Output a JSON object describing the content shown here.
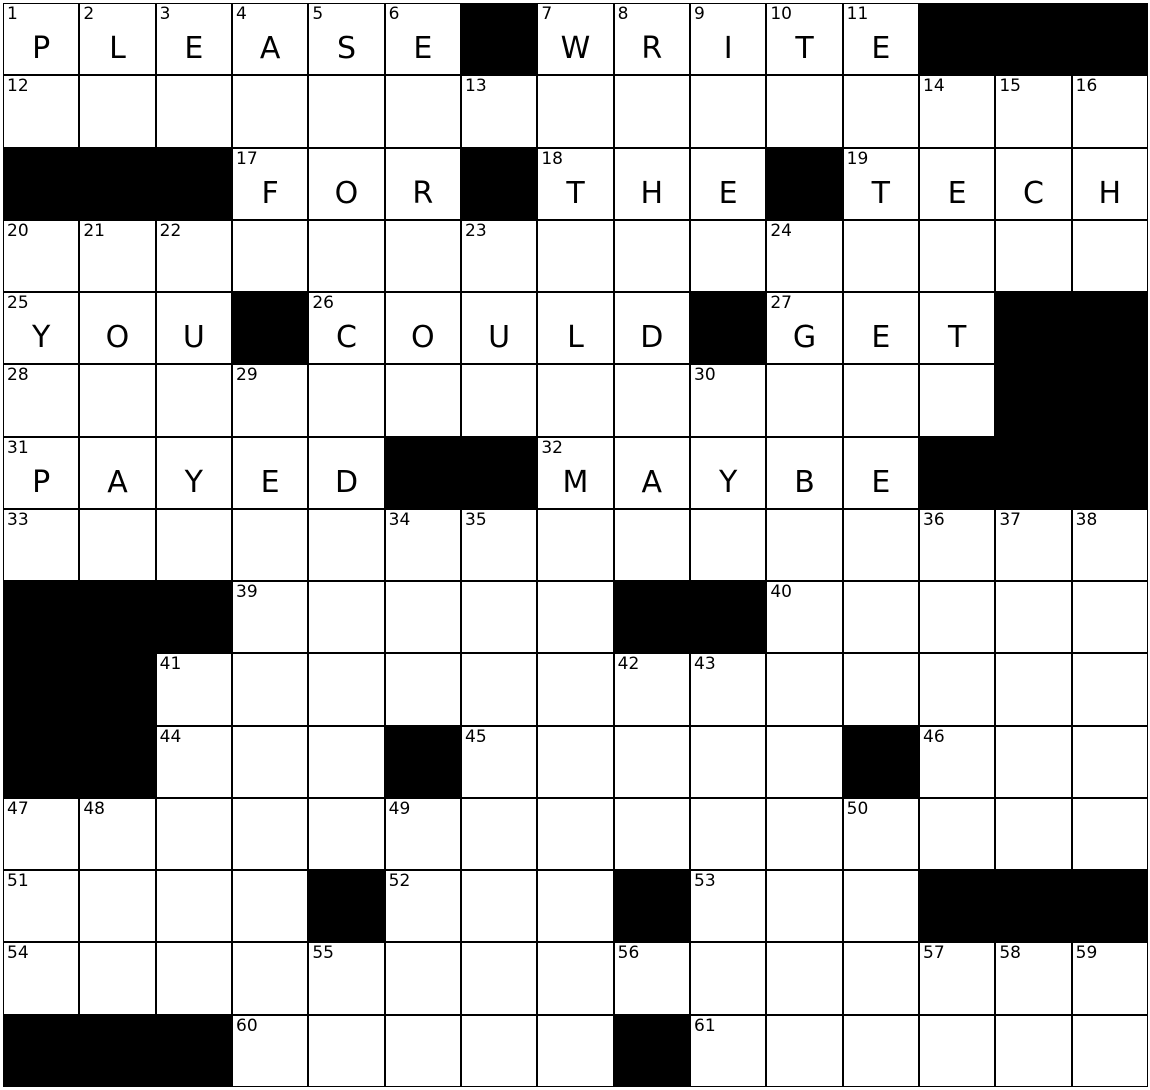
{
  "puzzle": {
    "rows": 15,
    "cols": 15,
    "grid": [
      "PLEASE.WRITE...",
      "...............",
      "...FOR.THE.TECH",
      "...............",
      "YOU.COULD.GET..",
      "...............",
      "PAYED..MAYBE...",
      "...............",
      "...............",
      "...............",
      "...............",
      "...............",
      "...............",
      "...............",
      "..............."
    ],
    "blocks": [
      [
        0,
        6
      ],
      [
        0,
        12
      ],
      [
        0,
        13
      ],
      [
        0,
        14
      ],
      [
        2,
        0
      ],
      [
        2,
        1
      ],
      [
        2,
        2
      ],
      [
        2,
        6
      ],
      [
        2,
        10
      ],
      [
        4,
        3
      ],
      [
        4,
        9
      ],
      [
        4,
        13
      ],
      [
        4,
        14
      ],
      [
        5,
        13
      ],
      [
        5,
        14
      ],
      [
        6,
        5
      ],
      [
        6,
        6
      ],
      [
        6,
        12
      ],
      [
        6,
        13
      ],
      [
        6,
        14
      ],
      [
        8,
        0
      ],
      [
        8,
        1
      ],
      [
        8,
        2
      ],
      [
        8,
        8
      ],
      [
        8,
        9
      ],
      [
        9,
        0
      ],
      [
        9,
        1
      ],
      [
        10,
        0
      ],
      [
        10,
        1
      ],
      [
        10,
        5
      ],
      [
        10,
        11
      ],
      [
        12,
        4
      ],
      [
        12,
        8
      ],
      [
        12,
        12
      ],
      [
        12,
        13
      ],
      [
        12,
        14
      ],
      [
        14,
        0
      ],
      [
        14,
        1
      ],
      [
        14,
        2
      ],
      [
        14,
        8
      ]
    ],
    "letters": [
      [
        0,
        0,
        "P"
      ],
      [
        0,
        1,
        "L"
      ],
      [
        0,
        2,
        "E"
      ],
      [
        0,
        3,
        "A"
      ],
      [
        0,
        4,
        "S"
      ],
      [
        0,
        5,
        "E"
      ],
      [
        0,
        7,
        "W"
      ],
      [
        0,
        8,
        "R"
      ],
      [
        0,
        9,
        "I"
      ],
      [
        0,
        10,
        "T"
      ],
      [
        0,
        11,
        "E"
      ],
      [
        2,
        3,
        "F"
      ],
      [
        2,
        4,
        "O"
      ],
      [
        2,
        5,
        "R"
      ],
      [
        2,
        7,
        "T"
      ],
      [
        2,
        8,
        "H"
      ],
      [
        2,
        9,
        "E"
      ],
      [
        2,
        11,
        "T"
      ],
      [
        2,
        12,
        "E"
      ],
      [
        2,
        13,
        "C"
      ],
      [
        2,
        14,
        "H"
      ],
      [
        4,
        0,
        "Y"
      ],
      [
        4,
        1,
        "O"
      ],
      [
        4,
        2,
        "U"
      ],
      [
        4,
        4,
        "C"
      ],
      [
        4,
        5,
        "O"
      ],
      [
        4,
        6,
        "U"
      ],
      [
        4,
        7,
        "L"
      ],
      [
        4,
        8,
        "D"
      ],
      [
        4,
        10,
        "G"
      ],
      [
        4,
        11,
        "E"
      ],
      [
        4,
        12,
        "T"
      ],
      [
        6,
        0,
        "P"
      ],
      [
        6,
        1,
        "A"
      ],
      [
        6,
        2,
        "Y"
      ],
      [
        6,
        3,
        "E"
      ],
      [
        6,
        4,
        "D"
      ],
      [
        6,
        7,
        "M"
      ],
      [
        6,
        8,
        "A"
      ],
      [
        6,
        9,
        "Y"
      ],
      [
        6,
        10,
        "B"
      ],
      [
        6,
        11,
        "E"
      ]
    ],
    "numbers": [
      [
        0,
        0,
        "1"
      ],
      [
        0,
        1,
        "2"
      ],
      [
        0,
        2,
        "3"
      ],
      [
        0,
        3,
        "4"
      ],
      [
        0,
        4,
        "5"
      ],
      [
        0,
        5,
        "6"
      ],
      [
        0,
        7,
        "7"
      ],
      [
        0,
        8,
        "8"
      ],
      [
        0,
        9,
        "9"
      ],
      [
        0,
        10,
        "10"
      ],
      [
        0,
        11,
        "11"
      ],
      [
        1,
        0,
        "12"
      ],
      [
        1,
        6,
        "13"
      ],
      [
        1,
        12,
        "14"
      ],
      [
        1,
        13,
        "15"
      ],
      [
        1,
        14,
        "16"
      ],
      [
        2,
        3,
        "17"
      ],
      [
        2,
        7,
        "18"
      ],
      [
        2,
        11,
        "19"
      ],
      [
        3,
        0,
        "20"
      ],
      [
        3,
        1,
        "21"
      ],
      [
        3,
        2,
        "22"
      ],
      [
        3,
        6,
        "23"
      ],
      [
        3,
        10,
        "24"
      ],
      [
        4,
        0,
        "25"
      ],
      [
        4,
        4,
        "26"
      ],
      [
        4,
        10,
        "27"
      ],
      [
        5,
        0,
        "28"
      ],
      [
        5,
        3,
        "29"
      ],
      [
        5,
        9,
        "30"
      ],
      [
        6,
        0,
        "31"
      ],
      [
        6,
        7,
        "32"
      ],
      [
        7,
        0,
        "33"
      ],
      [
        7,
        5,
        "34"
      ],
      [
        7,
        6,
        "35"
      ],
      [
        7,
        12,
        "36"
      ],
      [
        7,
        13,
        "37"
      ],
      [
        7,
        14,
        "38"
      ],
      [
        8,
        3,
        "39"
      ],
      [
        8,
        10,
        "40"
      ],
      [
        9,
        2,
        "41"
      ],
      [
        9,
        8,
        "42"
      ],
      [
        9,
        9,
        "43"
      ],
      [
        10,
        2,
        "44"
      ],
      [
        10,
        6,
        "45"
      ],
      [
        10,
        12,
        "46"
      ],
      [
        11,
        0,
        "47"
      ],
      [
        11,
        1,
        "48"
      ],
      [
        11,
        5,
        "49"
      ],
      [
        11,
        11,
        "50"
      ],
      [
        12,
        0,
        "51"
      ],
      [
        12,
        5,
        "52"
      ],
      [
        12,
        9,
        "53"
      ],
      [
        13,
        0,
        "54"
      ],
      [
        13,
        4,
        "55"
      ],
      [
        13,
        8,
        "56"
      ],
      [
        13,
        12,
        "57"
      ],
      [
        13,
        13,
        "58"
      ],
      [
        13,
        14,
        "59"
      ],
      [
        14,
        3,
        "60"
      ],
      [
        14,
        9,
        "61"
      ]
    ]
  },
  "colors": {
    "block": "#000000",
    "cell": "#ffffff",
    "text": "#000000"
  }
}
